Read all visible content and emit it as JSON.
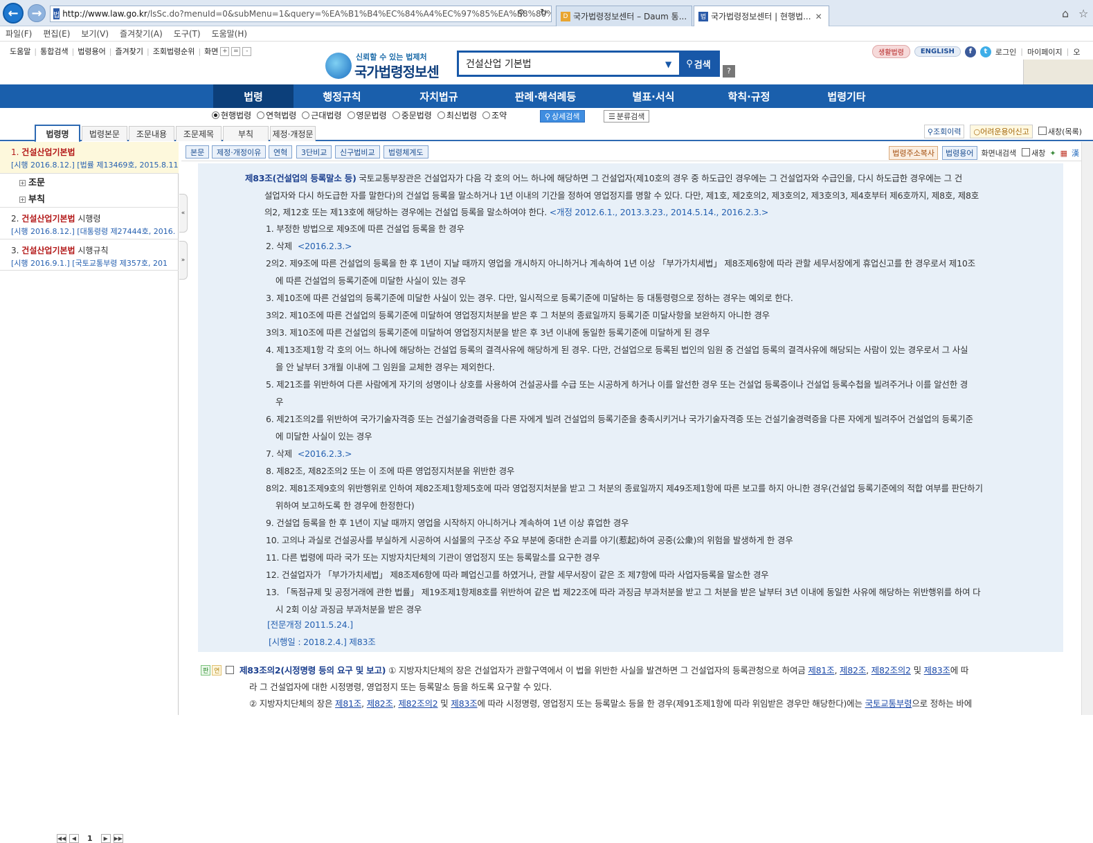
{
  "browser": {
    "url_host": "http://www.law.go.kr",
    "url_rest": "/lsSc.do?menuId=0&subMenu=1&query=%EA%B1%B4%EC%84%A4%EC%97%85%EA%B8%80%EB",
    "tabs": [
      {
        "label": "국가법령정보센터 – Daum 통..."
      },
      {
        "label": "국가법령정보센터 | 현행법...",
        "active": true
      }
    ],
    "menu": [
      "파일(F)",
      "편집(E)",
      "보기(V)",
      "즐겨찾기(A)",
      "도구(T)",
      "도움말(H)"
    ]
  },
  "header": {
    "util_links": [
      "도움말",
      "통합검색",
      "법령용어",
      "즐겨찾기",
      "조회법령순위",
      "화면"
    ],
    "zoom_buttons": [
      "+",
      "=",
      "-"
    ],
    "logo_tagline": "신뢰할 수 있는 법제처",
    "logo_title": "국가법령정보센터",
    "search_value": "건설산업 기본법",
    "search_button": "검색",
    "help": "?",
    "right_pills": [
      "생활법령",
      "ENGLISH"
    ],
    "right_links": [
      "로그인",
      "마이페이지",
      "오"
    ]
  },
  "main_nav": [
    "법령",
    "행정규칙",
    "자치법규",
    "판례·해석례등",
    "별표·서식",
    "학칙·규정",
    "법령기타"
  ],
  "radios": [
    "현행법령",
    "연혁법령",
    "근대법령",
    "영문법령",
    "중문법령",
    "최신법령",
    "조약"
  ],
  "radio_selected": 0,
  "detail_search": "상세검색",
  "class_search": "분류검색",
  "sub_tabs": [
    "법령명",
    "법령본문",
    "조문내용",
    "조문제목",
    "부칙",
    "제정·개정문"
  ],
  "sub_right": {
    "history": "조회이력",
    "report": "어려운용어신고",
    "window": "새창(목록)"
  },
  "left": {
    "items": [
      {
        "num": "1.",
        "title": "건설산업기본법",
        "suffix": "",
        "sub": "[시행 2016.8.12.] [법률 제13469호, 2015.8.11"
      },
      {
        "num": "2.",
        "title": "건설산업기본법",
        "suffix": " 시행령",
        "sub": "[시행 2016.8.12.] [대통령령 제27444호, 2016."
      },
      {
        "num": "3.",
        "title": "건설산업기본법",
        "suffix": " 시행규칙",
        "sub": "[시행 2016.9.1.] [국토교통부령 제357호, 201"
      }
    ],
    "tree": [
      "조문",
      "부칙"
    ],
    "page": "1"
  },
  "toolbar": {
    "buttons": [
      "본문",
      "제정·개정이유",
      "연혁",
      "3단비교",
      "신구법비교",
      "법령체계도"
    ],
    "right_buttons": [
      "법령주소복사",
      "법령용어"
    ],
    "search_label": "화면내검색",
    "newwin_label": "새창"
  },
  "article83": {
    "title": "제83조(건설업의 등록말소 등)",
    "lines": [
      "국토교통부장관은 건설업자가 다음 각 호의 어느 하나에 해당하면 그 건설업자(제10호의 경우 중 하도급인 경우에는 그 건설업자와 수급인을, 다시 하도급한 경우에는 그 건",
      "설업자와 다시 하도급한 자를 말한다)의 건설업 등록을 말소하거나 1년 이내의 기간을 정하여 영업정지를 명할 수 있다. 다만, 제1호, 제2호의2, 제3호의2, 제3호의3, 제4호부터 제6호까지, 제8호, 제8호",
      "의2, 제12호 또는 제13호에 해당하는 경우에는 건설업 등록을 말소하여야 한다."
    ],
    "amend": "<개정 2012.6.1., 2013.3.23., 2014.5.14., 2016.2.3.>",
    "items": [
      {
        "l1": "1. 부정한 방법으로 제9조에 따른 건설업 등록을 한 경우"
      },
      {
        "l1": "2. 삭제",
        "note": "<2016.2.3.>"
      },
      {
        "l1": "2의2. 제9조에 따른 건설업의 등록을 한 후 1년이 지날 때까지 영업을 개시하지 아니하거나 계속하여 1년 이상 「부가가치세법」 제8조제6항에 따라 관할 세무서장에게 휴업신고를 한 경우로서 제10조",
        "l2": "에 따른 건설업의 등록기준에 미달한 사실이 있는 경우"
      },
      {
        "l1": "3. 제10조에 따른 건설업의 등록기준에 미달한 사실이 있는 경우. 다만, 일시적으로 등록기준에 미달하는 등 대통령령으로 정하는 경우는 예외로 한다."
      },
      {
        "l1": "3의2. 제10조에 따른 건설업의 등록기준에 미달하여 영업정지처분을 받은 후 그 처분의 종료일까지 등록기준 미달사항을 보완하지 아니한 경우"
      },
      {
        "l1": "3의3. 제10조에 따른 건설업의 등록기준에 미달하여 영업정지처분을 받은 후 3년 이내에 동일한 등록기준에 미달하게 된 경우"
      },
      {
        "l1": "4. 제13조제1항 각 호의 어느 하나에 해당하는 건설업 등록의 결격사유에 해당하게 된 경우. 다만, 건설업으로 등록된 법인의 임원 중 건설업 등록의 결격사유에 해당되는 사람이 있는 경우로서 그 사실",
        "l2": "을 안 날부터 3개월 이내에 그 임원을 교체한 경우는 제외한다."
      },
      {
        "l1": "5. 제21조를 위반하여 다른 사람에게 자기의 성명이나 상호를 사용하여 건설공사를 수급 또는 시공하게 하거나 이를 알선한 경우 또는 건설업 등록증이나 건설업 등록수첩을 빌려주거나 이를 알선한 경",
        "l2": "우"
      },
      {
        "l1": "6. 제21조의2를 위반하여 국가기술자격증 또는 건설기술경력증을 다른 자에게 빌려 건설업의 등록기준을 충족시키거나 국가기술자격증 또는 건설기술경력증을 다른 자에게 빌려주어 건설업의 등록기준",
        "l2": "에 미달한 사실이 있는 경우"
      },
      {
        "l1": "7. 삭제",
        "note": "<2016.2.3.>"
      },
      {
        "l1": "8. 제82조, 제82조의2 또는 이 조에 따른 영업정지처분을 위반한 경우"
      },
      {
        "l1": "8의2. 제81조제9호의 위반행위로 인하여 제82조제1항제5호에 따라 영업정지처분을 받고 그 처분의 종료일까지 제49조제1항에 따른 보고를 하지 아니한 경우(건설업 등록기준에의 적합 여부를 판단하기",
        "l2": "위하여 보고하도록 한 경우에 한정한다)"
      },
      {
        "l1": "9. 건설업 등록을 한 후 1년이 지날 때까지 영업을 시작하지 아니하거나 계속하여 1년 이상 휴업한 경우"
      },
      {
        "l1": "10. 고의나 과실로 건설공사를 부실하게 시공하여 시설물의 구조상 주요 부분에 중대한 손괴를 야기(惹起)하여 공중(公衆)의 위험을 발생하게 한 경우"
      },
      {
        "l1": "11. 다른 법령에 따라 국가 또는 지방자치단체의 기관이 영업정지 또는 등록말소를 요구한 경우"
      },
      {
        "l1": "12. 건설업자가 「부가가치세법」 제8조제6항에 따라 폐업신고를 하였거나, 관할 세무서장이 같은 조 제7항에 따라 사업자등록을 말소한 경우"
      },
      {
        "l1": "13. 「독점규제 및 공정거래에 관한 법률」 제19조제1항제8호를 위반하여 같은 법 제22조에 따라 과징금 부과처분을 받고 그 처분을 받은 날부터 3년 이내에 동일한 사유에 해당하는 위반행위를 하여 다",
        "l2": "시 2회 이상 과징금 부과처분을 받은 경우"
      }
    ],
    "full_amend": "[전문개정 2011.5.24.]",
    "effective": "[시행일 : 2018.2.4.] 제83조"
  },
  "article83_2": {
    "badges": [
      "판",
      "연"
    ],
    "title": "제83조의2(시정명령 등의 요구 및 보고)",
    "p1_a": "① 지방자치단체의 장은 건설업자가 관할구역에서 이 법을 위반한 사실을 발견하면 그 건설업자의 등록관청으로 하여금",
    "p1_links": [
      "제81조",
      "제82조",
      "제82조의2",
      "제83조"
    ],
    "p1_b": "에 따",
    "p1_line2": "라 그 건설업자에 대한 시정명령, 영업정지 또는 등록말소 등을 하도록 요구할 수 있다.",
    "p2_a": "② 지방자치단체의 장은",
    "p2_links": [
      "제81조",
      "제82조",
      "제82조의2",
      "제83조"
    ],
    "p2_b": "에 따라 시정명령, 영업정지 또는 등록말소 등을 한 경우(제91조제1항에 따라 위임받은 경우만 해당한다)에는",
    "p2_link2": "국토교통부령",
    "p2_c": "으로 정하는 바에"
  }
}
